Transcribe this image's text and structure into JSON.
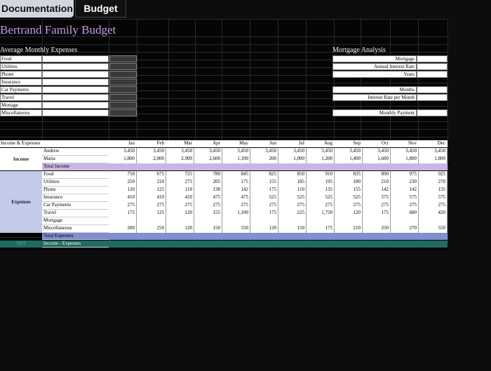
{
  "tabs": {
    "documentation": "Documentation",
    "budget": "Budget"
  },
  "title": "Bertrand Family Budget",
  "avg": {
    "heading": "Average Monthly Expenses",
    "items": [
      "Food",
      "Utilities",
      "Phone",
      "Insurance",
      "Car Payments",
      "Travel",
      "Mortage",
      "Miscellaneous"
    ]
  },
  "mortgage": {
    "heading": "Mortgage Analysis",
    "labels": [
      "Mortgage",
      "Annual Interest Rate",
      "Years"
    ],
    "months": "Months",
    "rate_month": "Interest Rate per Month",
    "payment": "Monthly Payment"
  },
  "table": {
    "corner": "Income & Expenses",
    "months": [
      "Jan",
      "Feb",
      "Mar",
      "Apr",
      "May",
      "Jun",
      "Jul",
      "Aug",
      "Sep",
      "Oct",
      "Nov",
      "Dec"
    ],
    "income_label": "Income",
    "expenses_label": "Expenses",
    "net_label": "NET",
    "income_rows": [
      {
        "name": "Andrew",
        "values": [
          "3,450",
          "3,450",
          "3,450",
          "3,450",
          "3,450",
          "3,450",
          "3,450",
          "3,450",
          "3,450",
          "3,450",
          "3,450",
          "3,450"
        ]
      },
      {
        "name": "Maria",
        "values": [
          "1,800",
          "2,000",
          "2,900",
          "2,600",
          "1,100",
          "200",
          "1,000",
          "1,200",
          "1,400",
          "1,600",
          "1,800",
          "1,800"
        ]
      }
    ],
    "total_income": "Total Income",
    "expense_rows": [
      {
        "name": "Food",
        "values": [
          "750",
          "675",
          "725",
          "780",
          "845",
          "825",
          "850",
          "910",
          "835",
          "890",
          "975",
          "925"
        ]
      },
      {
        "name": "Utilities",
        "values": [
          "250",
          "210",
          "275",
          "205",
          "175",
          "155",
          "185",
          "195",
          "180",
          "210",
          "230",
          "270"
        ]
      },
      {
        "name": "Phone",
        "values": [
          "120",
          "125",
          "110",
          "138",
          "142",
          "175",
          "110",
          "135",
          "155",
          "142",
          "142",
          "135"
        ]
      },
      {
        "name": "Insurance",
        "values": [
          "410",
          "410",
          "410",
          "475",
          "475",
          "525",
          "525",
          "525",
          "525",
          "575",
          "575",
          "575"
        ]
      },
      {
        "name": "Car Payments",
        "values": [
          "275",
          "275",
          "275",
          "275",
          "275",
          "275",
          "275",
          "275",
          "275",
          "275",
          "275",
          "275"
        ]
      },
      {
        "name": "Travel",
        "values": [
          "175",
          "125",
          "120",
          "155",
          "1,100",
          "175",
          "225",
          "1,750",
          "120",
          "175",
          "680",
          "420"
        ]
      },
      {
        "name": "Mortgage",
        "values": [
          "",
          "",
          "",
          "",
          "",
          "",
          "",
          "",
          "",
          "",
          "",
          ""
        ]
      },
      {
        "name": "Miscellaneous",
        "values": [
          "200",
          "250",
          "120",
          "150",
          "550",
          "120",
          "150",
          "175",
          "210",
          "250",
          "270",
          "550"
        ]
      }
    ],
    "total_expenses": "Total Expenses",
    "net_row": "Income - Expenses"
  }
}
